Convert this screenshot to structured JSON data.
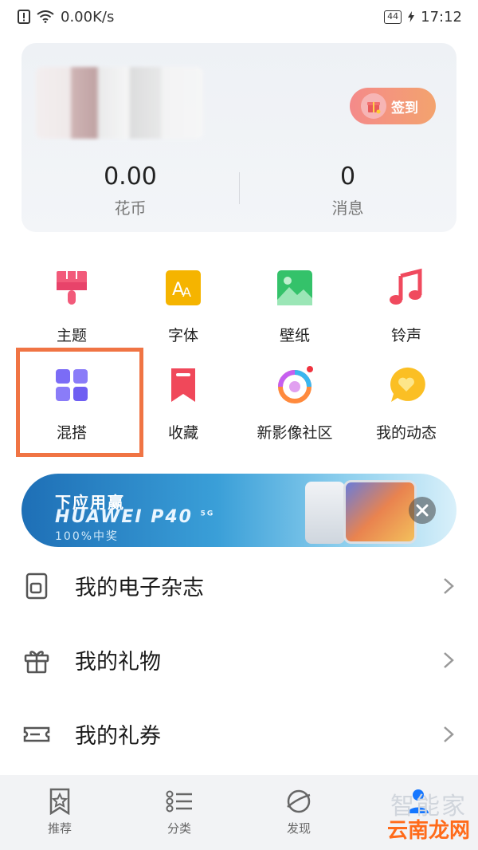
{
  "status": {
    "speed": "0.00K/s",
    "battery": "44",
    "time": "17:12"
  },
  "profile": {
    "sign_label": "签到",
    "stats": [
      {
        "value": "0.00",
        "label": "花币"
      },
      {
        "value": "0",
        "label": "消息"
      }
    ]
  },
  "grid": [
    {
      "label": "主题",
      "icon": "brush-icon"
    },
    {
      "label": "字体",
      "icon": "font-icon"
    },
    {
      "label": "壁纸",
      "icon": "wallpaper-icon"
    },
    {
      "label": "铃声",
      "icon": "music-note-icon"
    },
    {
      "label": "混搭",
      "icon": "grid-squares-icon"
    },
    {
      "label": "收藏",
      "icon": "bookmark-icon"
    },
    {
      "label": "新影像社区",
      "icon": "camera-ring-icon"
    },
    {
      "label": "我的动态",
      "icon": "heart-bubble-icon"
    }
  ],
  "banner": {
    "title": "下应用赢",
    "subtitle": "HUAWEI P40",
    "badge": "5G",
    "note": "100%中奖"
  },
  "menu": [
    {
      "label": "我的电子杂志",
      "icon": "magazine-icon"
    },
    {
      "label": "我的礼物",
      "icon": "gift-icon"
    },
    {
      "label": "我的礼券",
      "icon": "ticket-icon"
    }
  ],
  "nav": [
    {
      "label": "推荐",
      "icon": "star-bookmark-icon"
    },
    {
      "label": "分类",
      "icon": "list-icon"
    },
    {
      "label": "发现",
      "icon": "planet-icon"
    },
    {
      "label": "",
      "icon": "person-icon"
    }
  ],
  "watermark": {
    "main": "云南龙网",
    "faint": "智能家"
  },
  "colors": {
    "highlight": "#f07444",
    "sign_gradient": [
      "#f48a8a",
      "#f3a36e"
    ],
    "accent_blue": "#1677ff"
  }
}
